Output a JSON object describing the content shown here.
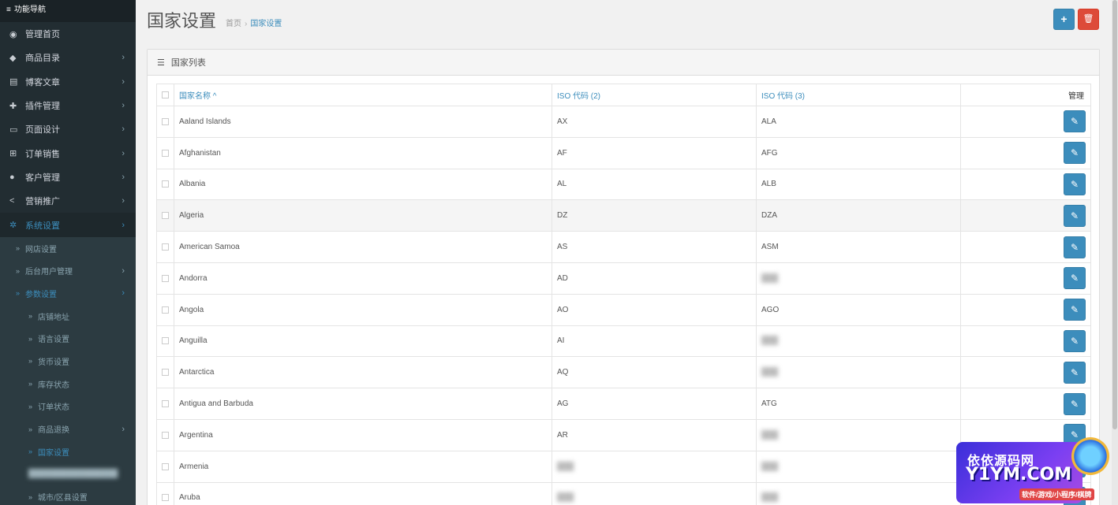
{
  "sidebar": {
    "title": "功能导航",
    "menu": [
      {
        "label": "管理首页",
        "icon": "dashboard-icon",
        "has_arrow": false
      },
      {
        "label": "商品目录",
        "icon": "tag-icon",
        "has_arrow": true
      },
      {
        "label": "博客文章",
        "icon": "newspaper-icon",
        "has_arrow": true
      },
      {
        "label": "插件管理",
        "icon": "puzzle-icon",
        "has_arrow": true
      },
      {
        "label": "页面设计",
        "icon": "desktop-icon",
        "has_arrow": true
      },
      {
        "label": "订单销售",
        "icon": "cart-icon",
        "has_arrow": true
      },
      {
        "label": "客户管理",
        "icon": "user-icon",
        "has_arrow": true
      },
      {
        "label": "营销推广",
        "icon": "share-icon",
        "has_arrow": true
      },
      {
        "label": "系统设置",
        "icon": "gear-icon",
        "has_arrow": true,
        "active": true
      }
    ],
    "system_submenu": [
      {
        "label": "网店设置",
        "level": 1,
        "has_arrow": false
      },
      {
        "label": "后台用户管理",
        "level": 1,
        "has_arrow": true
      },
      {
        "label": "参数设置",
        "level": 1,
        "has_arrow": true,
        "current": true
      }
    ],
    "params_submenu": [
      {
        "label": "店铺地址",
        "has_arrow": false
      },
      {
        "label": "语言设置",
        "has_arrow": false
      },
      {
        "label": "货币设置",
        "has_arrow": false
      },
      {
        "label": "库存状态",
        "has_arrow": false
      },
      {
        "label": "订单状态",
        "has_arrow": false
      },
      {
        "label": "商品退换",
        "has_arrow": true
      },
      {
        "label": "国家设置",
        "has_arrow": false,
        "current": true
      },
      {
        "label": "城市/区县设置",
        "has_arrow": false
      }
    ]
  },
  "header": {
    "title": "国家设置",
    "breadcrumb": [
      "首页",
      "国家设置"
    ]
  },
  "panel": {
    "title": "国家列表",
    "columns": {
      "name": "国家名称",
      "iso2": "ISO 代码 (2)",
      "iso3": "ISO 代码 (3)",
      "manage": "管理"
    },
    "rows": [
      {
        "name": "Aaland Islands",
        "iso2": "AX",
        "iso3": "ALA"
      },
      {
        "name": "Afghanistan",
        "iso2": "AF",
        "iso3": "AFG"
      },
      {
        "name": "Albania",
        "iso2": "AL",
        "iso3": "ALB"
      },
      {
        "name": "Algeria",
        "iso2": "DZ",
        "iso3": "DZA",
        "highlight": true
      },
      {
        "name": "American Samoa",
        "iso2": "AS",
        "iso3": "ASM"
      },
      {
        "name": "Andorra",
        "iso2": "AD",
        "iso3": "",
        "iso3_blurred": true
      },
      {
        "name": "Angola",
        "iso2": "AO",
        "iso3": "AGO"
      },
      {
        "name": "Anguilla",
        "iso2": "AI",
        "iso3": "",
        "iso3_blurred": true
      },
      {
        "name": "Antarctica",
        "iso2": "AQ",
        "iso3": "",
        "iso3_blurred": true
      },
      {
        "name": "Antigua and Barbuda",
        "iso2": "AG",
        "iso3": "ATG"
      },
      {
        "name": "Argentina",
        "iso2": "AR",
        "iso3": "",
        "iso3_blurred": true
      },
      {
        "name": "Armenia",
        "iso2": "",
        "iso2_blurred": true,
        "iso3": "",
        "iso3_blurred": true
      },
      {
        "name": "Aruba",
        "iso2": "",
        "iso2_blurred": true,
        "iso3": "",
        "iso3_blurred": true
      }
    ]
  },
  "watermark": {
    "line1": "依依源码网",
    "line2": "Y1YM.COM",
    "line3": "软件/游戏/小程序/棋牌"
  },
  "colors": {
    "sidebar_bg": "#222d32",
    "accent": "#3c8dbc",
    "danger": "#dd4b39"
  }
}
